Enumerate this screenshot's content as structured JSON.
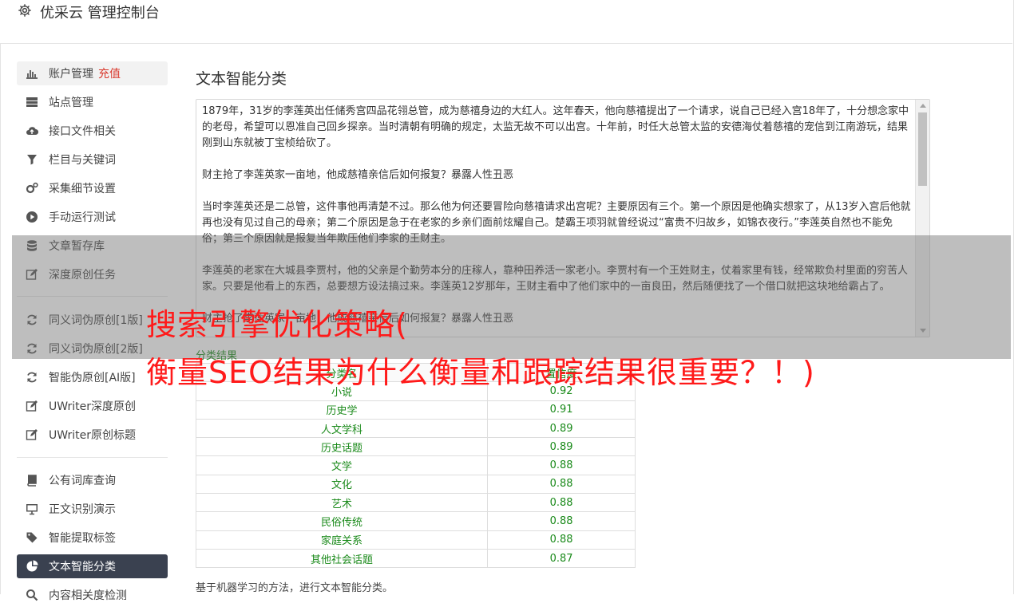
{
  "app": {
    "title": "优采云 管理控制台"
  },
  "sidebar": {
    "items": [
      {
        "label": "账户管理",
        "badge": "充值",
        "icon": "bar-chart-icon"
      },
      {
        "label": "站点管理",
        "icon": "server-icon"
      },
      {
        "label": "接口文件相关",
        "icon": "cloud-upload-icon"
      },
      {
        "label": "栏目与关键词",
        "icon": "filter-icon"
      },
      {
        "label": "采集细节设置",
        "icon": "gears-icon"
      },
      {
        "label": "手动运行测试",
        "icon": "play-circle-icon"
      },
      {
        "label": "文章暂存库",
        "icon": "database-icon"
      },
      {
        "label": "深度原创任务",
        "icon": "edit-icon"
      },
      {
        "label": "同义词伪原创[1版]",
        "icon": "refresh-icon"
      },
      {
        "label": "同义词伪原创[2版]",
        "icon": "refresh-icon"
      },
      {
        "label": "智能伪原创[AI版]",
        "icon": "refresh-icon"
      },
      {
        "label": "UWriter深度原创",
        "icon": "edit-icon"
      },
      {
        "label": "UWriter原创标题",
        "icon": "edit-icon"
      },
      {
        "label": "公有词库查询",
        "icon": "book-icon"
      },
      {
        "label": "正文识别演示",
        "icon": "monitor-icon"
      },
      {
        "label": "智能提取标签",
        "icon": "tag-icon"
      },
      {
        "label": "文本智能分类",
        "icon": "pie-chart-icon"
      },
      {
        "label": "内容相关度检测",
        "icon": "search-icon"
      }
    ]
  },
  "main": {
    "title": "文本智能分类",
    "text_paragraphs": [
      "1879年，31岁的李莲英出任储秀宫四品花翎总管，成为慈禧身边的大红人。这年春天，他向慈禧提出了一个请求，说自己已经入宫18年了，十分想念家中的老母，希望可以恩准自己回乡探亲。当时清朝有明确的规定，太监无故不可以出宫。十年前，时任大总管太监的安德海仗着慈禧的宠信到江南游玩，结果刚到山东就被丁宝桢给砍了。",
      "财主抢了李莲英家一亩地，他成慈禧亲信后如何报复？暴露人性丑恶",
      "当时李莲英还是二总管，这件事他再清楚不过。那么他为何还要冒险向慈禧请求出宫呢？主要原因有三个。第一个原因是他确实想家了，从13岁入宫后他就再也没有见过自己的母亲；第二个原因是急于在老家的乡亲们面前炫耀自己。楚霸王项羽就曾经说过“富贵不归故乡，如锦衣夜行。”李莲英自然也不能免俗；第三个原因就是报复当年欺压他们李家的王财主。",
      "李莲英的老家在大城县李贾村，他的父亲是个勤劳本分的庄稼人，靠种田养活一家老小。李贾村有一个王姓财主，仗着家里有钱，经常欺负村里面的穷苦人家。只要是他看上的东西，总要想方设法搞过来。李莲英12岁那年，王财主看中了他们家中的一亩良田，然后随便找了一个借口就把这块地给霸占了。",
      "财主抢了李莲英家一亩地，他成慈禧亲信后如何报复？暴露人性丑恶"
    ],
    "results_label": "分类结果",
    "table_headers": [
      "分类名",
      "置信度"
    ],
    "results": [
      {
        "category": "小说",
        "score": "0.92"
      },
      {
        "category": "历史学",
        "score": "0.91"
      },
      {
        "category": "人文学科",
        "score": "0.89"
      },
      {
        "category": "历史话题",
        "score": "0.89"
      },
      {
        "category": "文学",
        "score": "0.88"
      },
      {
        "category": "文化",
        "score": "0.88"
      },
      {
        "category": "艺术",
        "score": "0.88"
      },
      {
        "category": "民俗传统",
        "score": "0.88"
      },
      {
        "category": "家庭关系",
        "score": "0.88"
      },
      {
        "category": "其他社会话题",
        "score": "0.87"
      }
    ],
    "footnote": "基于机器学习的方法，进行文本智能分类。"
  },
  "overlay": {
    "line1": "搜索引擎优化策略(",
    "line2": "衡量SEO结果为什么衡量和跟踪结果很重要？！)"
  },
  "colors": {
    "accent_dark": "#3a4150",
    "result_green": "#1a8a1a",
    "recharge_red": "#d9392d",
    "headline_red": "#ff1a1a"
  }
}
